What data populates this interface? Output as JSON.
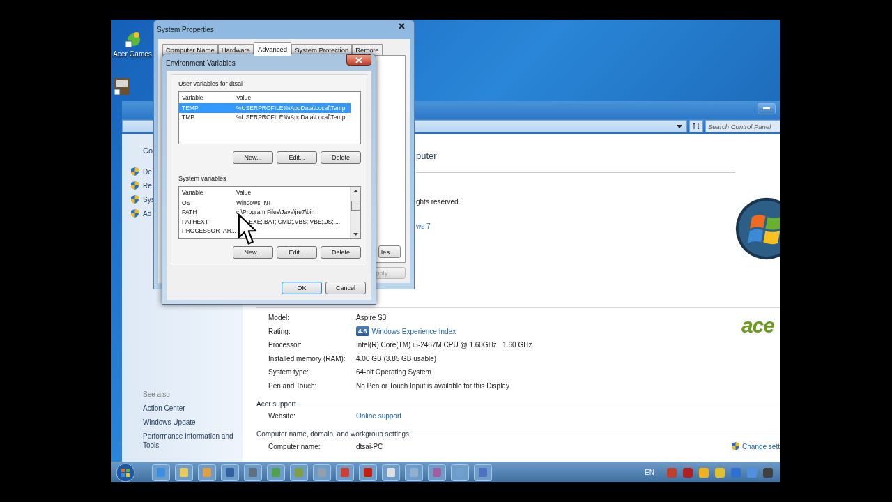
{
  "desktop": {
    "icons": [
      {
        "label": "Acer Games"
      }
    ]
  },
  "control_panel": {
    "search": {
      "placeholder": "Search Control Panel"
    },
    "sidebar": {
      "home": "Co",
      "tasks": [
        "De",
        "Re",
        "Sys",
        "Ad"
      ],
      "see_also_title": "See also",
      "see_also": [
        "Action Center",
        "Windows Update",
        "Performance Information and Tools"
      ]
    },
    "heading": "puter",
    "copyright": "ghts reserved.",
    "edition": "ws 7",
    "system": [
      {
        "label": "Model:",
        "kind": "text",
        "value": "Aspire S3"
      },
      {
        "label": "Rating:",
        "kind": "rating",
        "badge": "4.6",
        "value": "Windows Experience Index"
      },
      {
        "label": "Processor:",
        "kind": "text",
        "value": "Intel(R) Core(TM) i5-2467M CPU @ 1.60GHz   1.60 GHz"
      },
      {
        "label": "Installed memory (RAM):",
        "kind": "text",
        "value": "4.00 GB (3.85 GB usable)"
      },
      {
        "label": "System type:",
        "kind": "text",
        "value": "64-bit Operating System"
      },
      {
        "label": "Pen and Touch:",
        "kind": "text",
        "value": "No Pen or Touch Input is available for this Display"
      }
    ],
    "logo_text": "ace",
    "sections": [
      {
        "title": "Acer support",
        "rows": [
          {
            "label": "Website:",
            "kind": "link",
            "value": "Online support"
          }
        ]
      },
      {
        "title": "Computer name, domain, and workgroup settings",
        "rows": [
          {
            "label": "Computer name:",
            "kind": "text",
            "value": "dtsai-PC"
          }
        ],
        "action": "Change sett"
      }
    ]
  },
  "system_properties": {
    "title": "System Properties",
    "tabs": [
      {
        "label": "Computer Name",
        "selected": false
      },
      {
        "label": "Hardware",
        "selected": false
      },
      {
        "label": "Advanced",
        "selected": true
      },
      {
        "label": "System Protection",
        "selected": false
      },
      {
        "label": "Remote",
        "selected": false
      }
    ],
    "buttons": [
      {
        "label": "les...",
        "disabled": false
      },
      {
        "label": "pply",
        "disabled": true
      }
    ]
  },
  "environment_variables": {
    "title": "Environment Variables",
    "groups": [
      {
        "title": "User variables for dtsai",
        "columns": [
          "Variable",
          "Value"
        ],
        "scrollbar": false,
        "rows": [
          {
            "variable": "TEMP",
            "value": "%USERPROFILE%\\AppData\\Local\\Temp",
            "selected": true
          },
          {
            "variable": "TMP",
            "value": "%USERPROFILE%\\AppData\\Local\\Temp",
            "selected": false
          }
        ],
        "buttons": [
          "New...",
          "Edit...",
          "Delete"
        ]
      },
      {
        "title": "System variables",
        "columns": [
          "Variable",
          "Value"
        ],
        "scrollbar": true,
        "rows": [
          {
            "variable": "OS",
            "value": "Windows_NT",
            "selected": false
          },
          {
            "variable": "PATH",
            "value": "c:\\Program Files\\Java\\jre7\\bin",
            "selected": false
          },
          {
            "variable": "PATHEXT",
            "value": "EXE;.BAT;.CMD;.VBS;.VBE;.JS;....",
            "selected": false
          },
          {
            "variable": "PROCESSOR_AR...",
            "selected": false
          }
        ],
        "buttons": [
          "New...",
          "Edit...",
          "Delete"
        ]
      }
    ],
    "buttons": [
      "OK",
      "Cancel"
    ]
  },
  "taskbar": {
    "language": "EN"
  }
}
